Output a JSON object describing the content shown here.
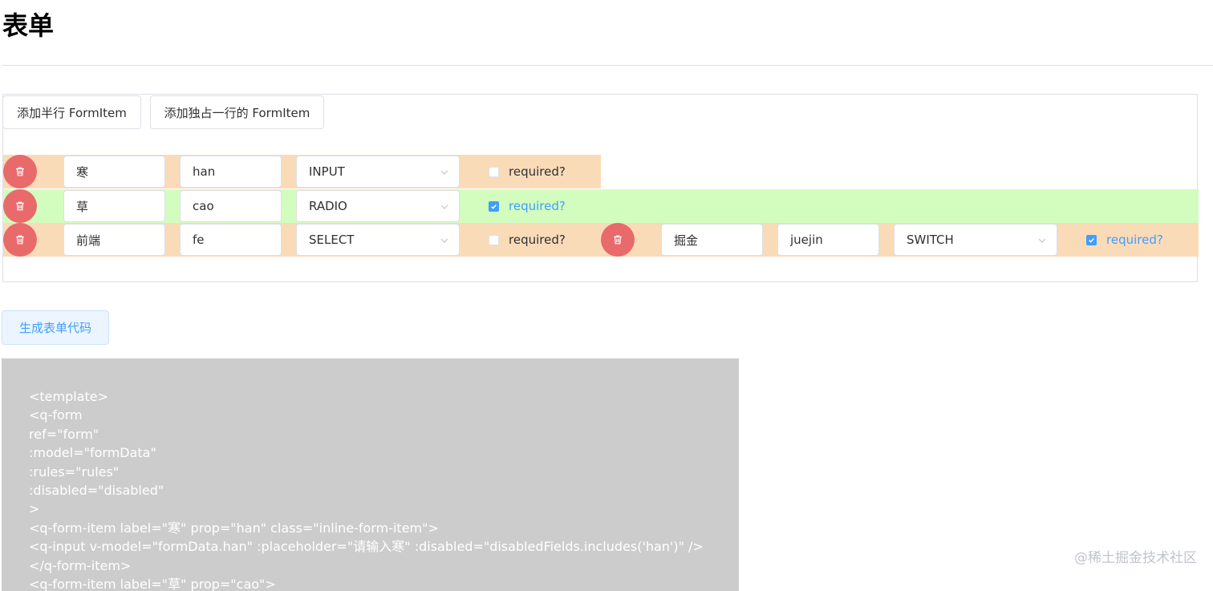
{
  "page": {
    "title": "表单"
  },
  "toolbar": {
    "add_half_label": "添加半行 FormItem",
    "add_full_label": "添加独占一行的 FormItem"
  },
  "colors": {
    "orange_row": "#fadbb8",
    "green_row": "#d2fdbf",
    "delete": "#e86a6a",
    "accent": "#409eff"
  },
  "rows": [
    {
      "items": [
        {
          "label": "寒",
          "prop": "han",
          "type": "INPUT",
          "required_label": "required?",
          "required": false
        }
      ]
    },
    {
      "items": [
        {
          "label": "草",
          "prop": "cao",
          "type": "RADIO",
          "required_label": "required?",
          "required": true
        }
      ]
    },
    {
      "items": [
        {
          "label": "前端",
          "prop": "fe",
          "type": "SELECT",
          "required_label": "required?",
          "required": false
        },
        {
          "label": "掘金",
          "prop": "juejin",
          "type": "SWITCH",
          "required_label": "required?",
          "required": true
        }
      ]
    }
  ],
  "generate_label": "生成表单代码",
  "code_lines": [
    "<template>",
    "<q-form",
    "ref=\"form\"",
    ":model=\"formData\"",
    ":rules=\"rules\"",
    ":disabled=\"disabled\"",
    ">",
    "<q-form-item label=\"寒\" prop=\"han\" class=\"inline-form-item\">",
    "<q-input v-model=\"formData.han\" :placeholder=\"请输入寒\" :disabled=\"disabledFields.includes('han')\" />",
    "</q-form-item>",
    "<q-form-item label=\"草\" prop=\"cao\">"
  ],
  "watermark": "@稀土掘金技术社区"
}
